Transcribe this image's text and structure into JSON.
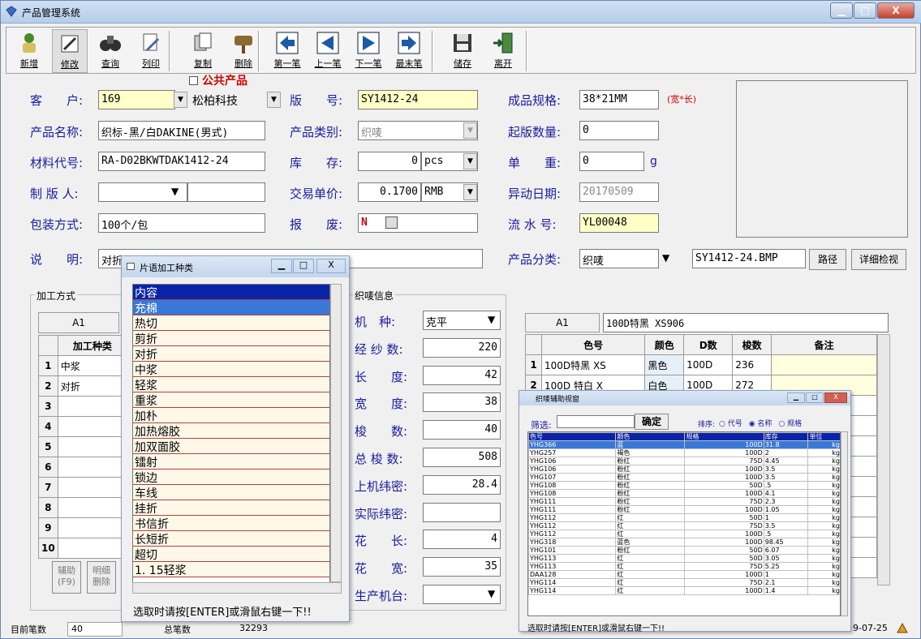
{
  "window": {
    "title": "产品管理系统"
  },
  "toolbar": [
    {
      "id": "new",
      "label": "新增",
      "icon": "person-add-icon"
    },
    {
      "id": "edit",
      "label": "修改",
      "icon": "pencil-edit-icon"
    },
    {
      "id": "query",
      "label": "查询",
      "icon": "binoculars-icon"
    },
    {
      "id": "print",
      "label": "列印",
      "icon": "printer-icon"
    },
    {
      "id": "copy",
      "label": "复制",
      "icon": "copy-icon"
    },
    {
      "id": "delete",
      "label": "删除",
      "icon": "dump-sign-icon"
    },
    {
      "id": "first",
      "label": "第一笔",
      "icon": "arrow-first-icon"
    },
    {
      "id": "prev",
      "label": "上一笔",
      "icon": "arrow-prev-icon"
    },
    {
      "id": "next",
      "label": "下一笔",
      "icon": "arrow-next-icon"
    },
    {
      "id": "last",
      "label": "最末笔",
      "icon": "arrow-last-icon"
    },
    {
      "id": "save",
      "label": "储存",
      "icon": "floppy-disk-icon"
    },
    {
      "id": "exit",
      "label": "离开",
      "icon": "exit-door-icon"
    }
  ],
  "form": {
    "customer_label": "客　　户:",
    "customer_value": "169",
    "customer_name": "松柏科技",
    "public_label": "公共产品",
    "version_label": "版　　号:",
    "version_value": "SY1412-24",
    "spec_label": "成品规格:",
    "spec_value": "38*21MM",
    "spec_unit": "(宽*长)",
    "pname_label": "产品名称:",
    "pname_value": "织标-黑/白DAKINE(男式)",
    "ptype_label": "产品类别:",
    "ptype_value": "织唛",
    "minqty_label": "起版数量:",
    "minqty_value": "0",
    "material_label": "材料代号:",
    "material_value": "RA-D02BKWTDAK1412-24",
    "stock_label": "库　　存:",
    "stock_value": "0",
    "stock_unit": "pcs",
    "weight_label": "单　　重:",
    "weight_value": "0",
    "weight_unit": "g",
    "maker_label": "制 版 人:",
    "maker_value": "",
    "price_label": "交易单价:",
    "price_value": "0.1700",
    "price_unit": "RMB",
    "change_label": "异动日期:",
    "change_value": "20170509",
    "pack_label": "包装方式:",
    "pack_value": "100个/包",
    "scrap_label": "报　　废:",
    "scrap_value": "N",
    "serial_label": "流 水 号:",
    "serial_value": "YL00048",
    "note_label": "说　　明:",
    "note_value": "对折后两头折一下不开缝",
    "category_label": "产品分类:",
    "category_value": "织唛",
    "file_value": "SY1412-24.BMP",
    "path_btn": "路径",
    "detail_btn": "详细检视"
  },
  "process": {
    "title": "加工方式",
    "cell_ref": "A1",
    "col_header": "加工种类",
    "rows": [
      {
        "no": "1",
        "name": "中浆"
      },
      {
        "no": "2",
        "name": "对折"
      },
      {
        "no": "3",
        "name": ""
      },
      {
        "no": "4",
        "name": ""
      },
      {
        "no": "5",
        "name": ""
      },
      {
        "no": "6",
        "name": ""
      },
      {
        "no": "7",
        "name": ""
      },
      {
        "no": "8",
        "name": ""
      },
      {
        "no": "9",
        "name": ""
      },
      {
        "no": "10",
        "name": ""
      }
    ],
    "aux_btn": "辅助\n(F9)",
    "detail_del_btn": "明细\n删除"
  },
  "weave": {
    "title": "织唛信息",
    "fields": [
      {
        "label": "机　种:",
        "value": "克平",
        "dd": true
      },
      {
        "label": "经 纱 数:",
        "value": "220"
      },
      {
        "label": "长　　度:",
        "value": "42"
      },
      {
        "label": "宽　　度:",
        "value": "38"
      },
      {
        "label": "梭　　数:",
        "value": "40"
      },
      {
        "label": "总 梭 数:",
        "value": "508"
      },
      {
        "label": "上机纬密:",
        "value": "28.4"
      },
      {
        "label": "实际纬密:",
        "value": ""
      },
      {
        "label": "花　　长:",
        "value": "4"
      },
      {
        "label": "花　　宽:",
        "value": "35"
      },
      {
        "label": "生产机台:",
        "value": "",
        "dd": true
      }
    ]
  },
  "yarn": {
    "cell_ref": "A1",
    "cell_value": "100D特黑 XS906",
    "headers": [
      "色号",
      "颜色",
      "D数",
      "梭数",
      "备注"
    ],
    "rows": [
      {
        "no": "1",
        "code": "100D特黑 XS",
        "color": "黑色",
        "d": "100D",
        "shuttle": "236",
        "note": ""
      },
      {
        "no": "2",
        "code": "100D 特白 X",
        "color": "白色",
        "d": "100D",
        "shuttle": "272",
        "note": ""
      }
    ]
  },
  "phrase_popup": {
    "title": "片语加工种类",
    "items": [
      "内容",
      "充棉",
      "热切",
      "剪折",
      "对折",
      "中浆",
      "轻浆",
      "重浆",
      "加朴",
      "加热熔胶",
      "加双面胶",
      "镭射",
      "锁边",
      "车线",
      "挂折",
      "书信折",
      "长短折",
      "超切",
      "1. 15轻浆"
    ],
    "hint": "选取时请按[ENTER]或滑鼠右键一下!!"
  },
  "assist_popup": {
    "title": "织唛辅助视窗",
    "filter_label": "筛选:",
    "ok_btn": "确定",
    "sort_label": "排序:",
    "sort_opts": [
      "代号",
      "名称",
      "规格"
    ],
    "headers": [
      "色号",
      "颜色",
      "规格",
      "库存",
      "单位"
    ],
    "rows": [
      [
        "YHG366",
        "蓝",
        "100D",
        "31.8",
        "kg"
      ],
      [
        "YHG257",
        "褐色",
        "100D",
        "2",
        "kg"
      ],
      [
        "YHG106",
        "粉红",
        "75D",
        "4.45",
        "kg"
      ],
      [
        "YHG106",
        "粉红",
        "100D",
        "3.5",
        "kg"
      ],
      [
        "YHG107",
        "粉红",
        "100D",
        "3.5",
        "kg"
      ],
      [
        "YHG108",
        "粉红",
        "50D",
        ".5",
        "kg"
      ],
      [
        "YHG108",
        "粉红",
        "100D",
        "4.1",
        "kg"
      ],
      [
        "YHG111",
        "粉红",
        "75D",
        "2.3",
        "kg"
      ],
      [
        "YHG111",
        "粉红",
        "100D",
        "1.05",
        "kg"
      ],
      [
        "YHG112",
        "红",
        "50D",
        "1",
        "kg"
      ],
      [
        "YHG112",
        "红",
        "75D",
        "3.5",
        "kg"
      ],
      [
        "YHG112",
        "红",
        "100D",
        ".5",
        "kg"
      ],
      [
        "YHG318",
        "蓝色",
        "100D",
        "98.45",
        "kg"
      ],
      [
        "YHG101",
        "粉红",
        "50D",
        "6.07",
        "kg"
      ],
      [
        "YHG113",
        "红",
        "50D",
        "3.05",
        "kg"
      ],
      [
        "YHG113",
        "红",
        "75D",
        "5.25",
        "kg"
      ],
      [
        "DAA128",
        "红",
        "100D",
        "1",
        "kg"
      ],
      [
        "YHG114",
        "红",
        "75D",
        "2.1",
        "kg"
      ],
      [
        "YHG114",
        "红",
        "100D",
        "1.4",
        "kg"
      ]
    ],
    "hint": "选取时请按[ENTER]或滑鼠右键一下!!"
  },
  "status": {
    "current_label": "目前笔数",
    "current_value": "40",
    "total_label": "总笔数",
    "total_value": "32293",
    "date_tail": "9-07-25"
  }
}
